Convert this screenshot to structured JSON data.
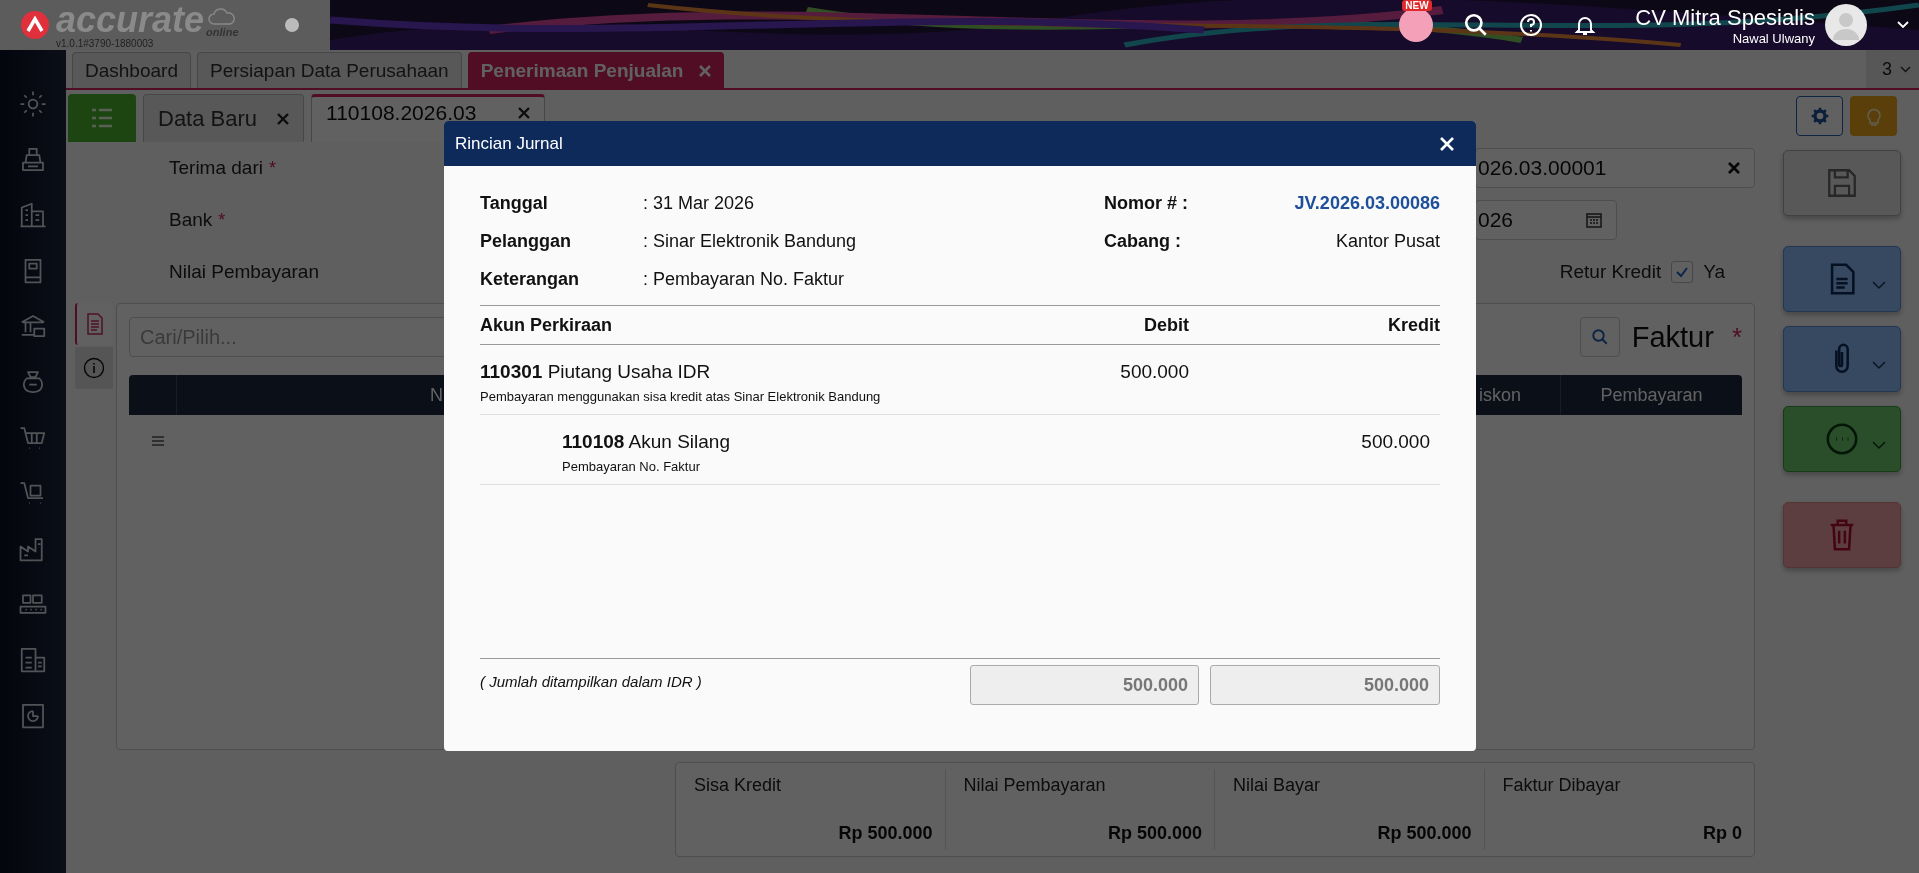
{
  "header": {
    "logo": "accurate",
    "logo_sub": "online",
    "version": "v1.0.1#3790-1880003",
    "new_badge": "NEW",
    "company": "CV Mitra Spesialis",
    "user": "Nawal Ulwany"
  },
  "module_tabs": [
    {
      "label": "Dashboard",
      "selected": false
    },
    {
      "label": "Persiapan Data Perusahaan",
      "selected": false
    },
    {
      "label": "Penerimaan Penjualan",
      "selected": true
    }
  ],
  "tab_count": "3",
  "doc_tabs": [
    {
      "label": "Data Baru",
      "selected": false
    },
    {
      "label": "110108.2026.03",
      "selected": true
    }
  ],
  "form": {
    "labels": [
      {
        "text": "Terima dari",
        "required_mark": "*"
      },
      {
        "text": "Bank",
        "required_mark": "*"
      },
      {
        "text": "Nilai Pembayaran"
      }
    ],
    "right": [
      {
        "kind": "clearable",
        "value": "026.03.00001"
      },
      {
        "kind": "date",
        "value": "026"
      },
      {
        "kind": "checkbox",
        "label": "Retur Kredit",
        "checked": true,
        "option": "Ya"
      }
    ]
  },
  "detail": {
    "search_placeholder": "Cari/Pilih...",
    "faktur_label": "Faktur",
    "faktur_mark": "*",
    "columns": [
      "N",
      "iskon",
      "Pembayaran"
    ]
  },
  "summary": [
    {
      "label": "Sisa Kredit",
      "value": "Rp 500.000"
    },
    {
      "label": "Nilai Pembayaran",
      "value": "Rp 500.000"
    },
    {
      "label": "Nilai Bayar",
      "value": "Rp 500.000"
    },
    {
      "label": "Faktur Dibayar",
      "value": "Rp 0"
    }
  ],
  "dialog": {
    "title": "Rincian Jurnal",
    "info_left": [
      {
        "label": "Tanggal",
        "value": ": 31 Mar 2026"
      },
      {
        "label": "Pelanggan",
        "value": ": Sinar Elektronik Bandung"
      },
      {
        "label": "Keterangan",
        "value": ": Pembayaran No. Faktur"
      }
    ],
    "info_right": [
      {
        "label": "Nomor # :",
        "value": "JV.2026.03.00086",
        "kind": "link"
      },
      {
        "label": "Cabang :",
        "value": "Kantor Pusat",
        "kind": "text"
      }
    ],
    "columns": [
      "Akun Perkiraan",
      "Debit",
      "Kredit"
    ],
    "entries": [
      {
        "kind": "debit",
        "code": "110301",
        "name": "Piutang Usaha IDR",
        "note": "Pembayaran menggunakan sisa kredit atas Sinar Elektronik Bandung",
        "amount": "500.000"
      },
      {
        "kind": "credit",
        "code": "110108",
        "name": "Akun Silang",
        "note": "Pembayaran No. Faktur",
        "amount": "500.000"
      }
    ],
    "footnote": "( Jumlah ditampilkan dalam IDR )",
    "total_debit": "500.000",
    "total_credit": "500.000"
  }
}
